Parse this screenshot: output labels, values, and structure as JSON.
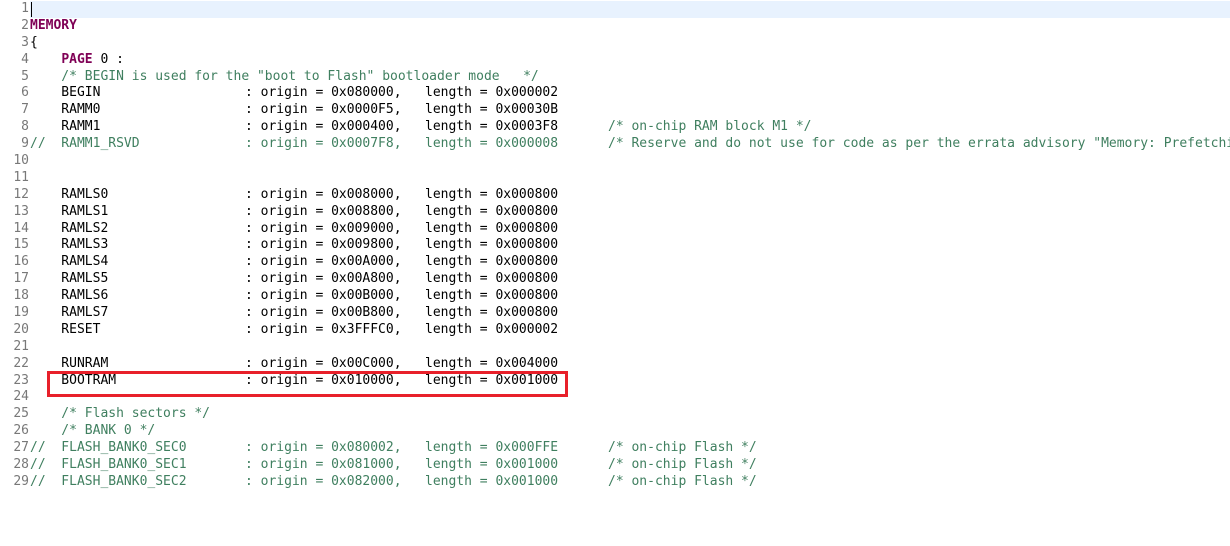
{
  "editor": {
    "lines": [
      {
        "no": "1",
        "segments": []
      },
      {
        "no": "2",
        "segments": [
          {
            "type": "kw",
            "text": "MEMORY"
          }
        ]
      },
      {
        "no": "3",
        "segments": [
          {
            "type": "plain",
            "text": "{"
          }
        ]
      },
      {
        "no": "4",
        "segments": [
          {
            "type": "plain",
            "text": "    "
          },
          {
            "type": "kw",
            "text": "PAGE"
          },
          {
            "type": "plain",
            "text": " 0 :"
          }
        ]
      },
      {
        "no": "5",
        "segments": [
          {
            "type": "cm",
            "text": "    /* BEGIN is used for the \"boot to Flash\" bootloader mode   */"
          }
        ]
      },
      {
        "no": "6",
        "cols": {
          "prefix": "",
          "name": "    BEGIN",
          "origin": ": origin = 0x080000,",
          "length": "length = 0x000002",
          "comment": ""
        }
      },
      {
        "no": "7",
        "cols": {
          "prefix": "",
          "name": "    RAMM0",
          "origin": ": origin = 0x0000F5,",
          "length": "length = 0x00030B",
          "comment": ""
        }
      },
      {
        "no": "8",
        "cols": {
          "prefix": "",
          "name": "    RAMM1",
          "origin": ": origin = 0x000400,",
          "length": "length = 0x0003F8",
          "comment": "/* on-chip RAM block M1 */"
        }
      },
      {
        "no": "9",
        "commented": true,
        "cols": {
          "prefix": "//",
          "name": "  RAMM1_RSVD",
          "origin": ": origin = 0x0007F8,",
          "length": "length = 0x000008",
          "comment": "/* Reserve and do not use for code as per the errata advisory \"Memory: Prefetching"
        }
      },
      {
        "no": "10",
        "segments": []
      },
      {
        "no": "11",
        "segments": []
      },
      {
        "no": "12",
        "cols": {
          "prefix": "",
          "name": "    RAMLS0",
          "origin": ": origin = 0x008000,",
          "length": "length = 0x000800",
          "comment": ""
        }
      },
      {
        "no": "13",
        "cols": {
          "prefix": "",
          "name": "    RAMLS1",
          "origin": ": origin = 0x008800,",
          "length": "length = 0x000800",
          "comment": ""
        }
      },
      {
        "no": "14",
        "cols": {
          "prefix": "",
          "name": "    RAMLS2",
          "origin": ": origin = 0x009000,",
          "length": "length = 0x000800",
          "comment": ""
        }
      },
      {
        "no": "15",
        "cols": {
          "prefix": "",
          "name": "    RAMLS3",
          "origin": ": origin = 0x009800,",
          "length": "length = 0x000800",
          "comment": ""
        }
      },
      {
        "no": "16",
        "cols": {
          "prefix": "",
          "name": "    RAMLS4",
          "origin": ": origin = 0x00A000,",
          "length": "length = 0x000800",
          "comment": ""
        }
      },
      {
        "no": "17",
        "cols": {
          "prefix": "",
          "name": "    RAMLS5",
          "origin": ": origin = 0x00A800,",
          "length": "length = 0x000800",
          "comment": ""
        }
      },
      {
        "no": "18",
        "cols": {
          "prefix": "",
          "name": "    RAMLS6",
          "origin": ": origin = 0x00B000,",
          "length": "length = 0x000800",
          "comment": ""
        }
      },
      {
        "no": "19",
        "cols": {
          "prefix": "",
          "name": "    RAMLS7",
          "origin": ": origin = 0x00B800,",
          "length": "length = 0x000800",
          "comment": ""
        }
      },
      {
        "no": "20",
        "cols": {
          "prefix": "",
          "name": "    RESET",
          "origin": ": origin = 0x3FFFC0,",
          "length": "length = 0x000002",
          "comment": ""
        }
      },
      {
        "no": "21",
        "segments": []
      },
      {
        "no": "22",
        "cols": {
          "prefix": "",
          "name": "    RUNRAM",
          "origin": ": origin = 0x00C000,",
          "length": "length = 0x004000",
          "comment": ""
        }
      },
      {
        "no": "23",
        "highlighted": true,
        "cols": {
          "prefix": "",
          "name": "    BOOTRAM",
          "origin": ": origin = 0x010000,",
          "length": "length = 0x001000",
          "comment": ""
        }
      },
      {
        "no": "24",
        "segments": []
      },
      {
        "no": "25",
        "segments": [
          {
            "type": "cm",
            "text": "    /* Flash sectors */"
          }
        ]
      },
      {
        "no": "26",
        "segments": [
          {
            "type": "cm",
            "text": "    /* BANK 0 */"
          }
        ]
      },
      {
        "no": "27",
        "commented": true,
        "cols": {
          "prefix": "//",
          "name": "  FLASH_BANK0_SEC0",
          "origin": ": origin = 0x080002,",
          "length": "length = 0x000FFE",
          "comment": "/* on-chip Flash */"
        }
      },
      {
        "no": "28",
        "commented": true,
        "cols": {
          "prefix": "//",
          "name": "  FLASH_BANK0_SEC1",
          "origin": ": origin = 0x081000,",
          "length": "length = 0x001000",
          "comment": "/* on-chip Flash */"
        }
      },
      {
        "no": "29",
        "commented": true,
        "cols": {
          "prefix": "//",
          "name": "  FLASH_BANK0_SEC2",
          "origin": ": origin = 0x082000,",
          "length": "length = 0x001000",
          "comment": "/* on-chip Flash */"
        }
      }
    ],
    "colors": {
      "keyword": "#7f0055",
      "comment": "#3f7f5f",
      "line_number": "#787878",
      "current_line": "#e8f2fe",
      "highlight_box": "#e8202a"
    }
  }
}
